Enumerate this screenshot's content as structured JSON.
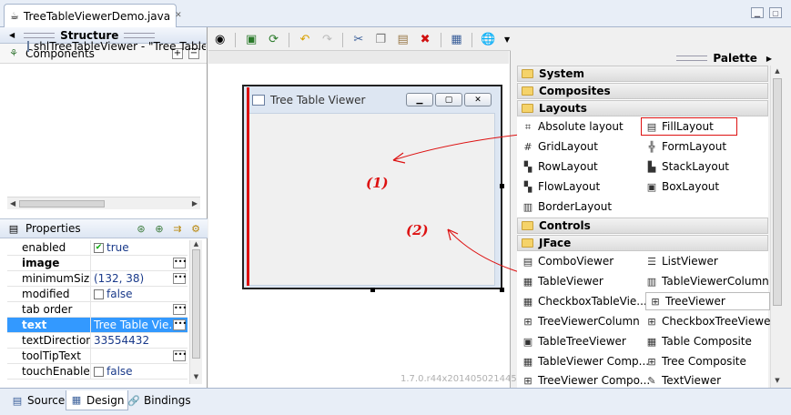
{
  "editor_tab": {
    "title": "TreeTableViewerDemo.java",
    "close": "✕"
  },
  "structure": {
    "title": "Structure",
    "components_label": "Components",
    "tree_item": "shlTreeTableViewer - \"Tree Table",
    "properties_label": "Properties",
    "properties": [
      {
        "name": "enabled",
        "value": "true",
        "checkbox": true,
        "checked": true,
        "bold": false
      },
      {
        "name": "image",
        "value": "",
        "checkbox": false,
        "bold": true
      },
      {
        "name": "minimumSize",
        "value": "(132, 38)",
        "checkbox": false,
        "bold": false
      },
      {
        "name": "modified",
        "value": "false",
        "checkbox": true,
        "checked": false,
        "bold": false
      },
      {
        "name": "tab order",
        "value": "",
        "checkbox": false,
        "bold": false
      },
      {
        "name": "text",
        "value": "Tree Table Vie...",
        "checkbox": false,
        "bold": true,
        "selected": true
      },
      {
        "name": "textDirection",
        "value": "33554432",
        "checkbox": false,
        "bold": false
      },
      {
        "name": "toolTipText",
        "value": "",
        "checkbox": false,
        "bold": false
      },
      {
        "name": "touchEnabled",
        "value": "false",
        "checkbox": true,
        "checked": false,
        "bold": false
      }
    ]
  },
  "design": {
    "shell_title": "Tree Table Viewer",
    "annotation_1": "(1)",
    "annotation_2": "(2)",
    "version": "1.7.0.r44x201405021445"
  },
  "palette": {
    "title": "Palette",
    "categories": {
      "system": "System",
      "composites": "Composites",
      "layouts": "Layouts",
      "controls": "Controls",
      "jface": "JFace"
    },
    "layouts": [
      "Absolute layout",
      "FillLayout",
      "GridLayout",
      "FormLayout",
      "RowLayout",
      "StackLayout",
      "FlowLayout",
      "BoxLayout",
      "BorderLayout"
    ],
    "jface": [
      "ComboViewer",
      "ListViewer",
      "TableViewer",
      "TableViewerColumn",
      "CheckboxTableVie...",
      "TreeViewer",
      "TreeViewerColumn",
      "CheckboxTreeViewer",
      "TableTreeViewer",
      "Table Composite",
      "TableViewer Comp...",
      "Tree Composite",
      "TreeViewer Compo...",
      "TextViewer"
    ]
  },
  "bottom_tabs": [
    "Source",
    "Design",
    "Bindings"
  ],
  "colors": {
    "annotation": "#dd1111",
    "selection": "#3399ff"
  }
}
